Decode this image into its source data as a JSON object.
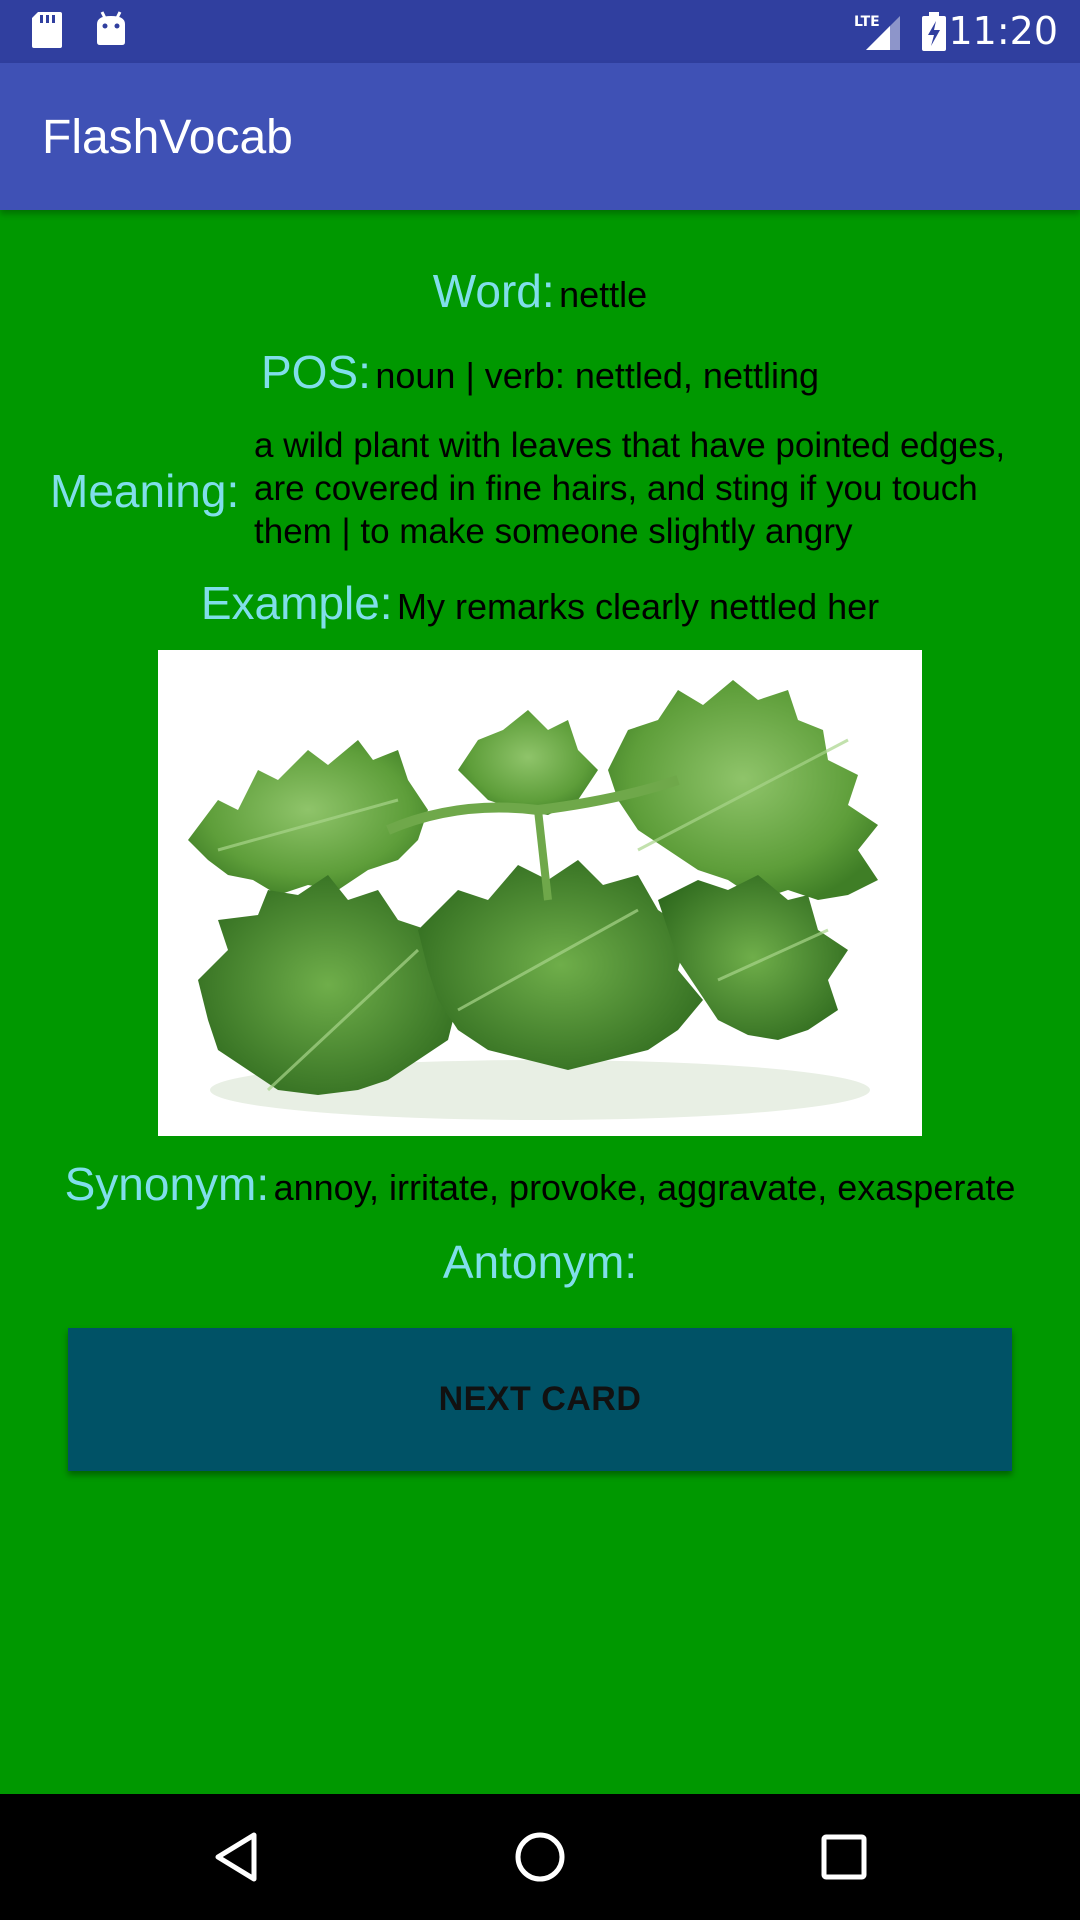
{
  "status_bar": {
    "time": "11:20",
    "network": "LTE",
    "icons": [
      "sd-card-icon",
      "android-icon",
      "signal-icon",
      "battery-charging-icon"
    ]
  },
  "app_bar": {
    "title": "FlashVocab"
  },
  "card": {
    "word_label": "Word:",
    "word": "nettle",
    "pos_label": "POS:",
    "pos": "noun | verb: nettled, nettling",
    "meaning_label": "Meaning:",
    "meaning": "a wild plant with leaves that have pointed edges, are covered in fine hairs, and sting if you touch them | to make someone slightly angry",
    "example_label": "Example:",
    "example": "My remarks clearly nettled her",
    "synonym_label": "Synonym:",
    "synonym": "annoy, irritate, provoke, aggravate, exasperate",
    "antonym_label": "Antonym:",
    "antonym": ""
  },
  "button": {
    "next_label": "NEXT CARD"
  },
  "nav_bar": {
    "icons": [
      "back-icon",
      "home-icon",
      "recents-icon"
    ]
  },
  "colors": {
    "status_bar": "#303F9F",
    "app_bar": "#3F51B5",
    "background": "#009800",
    "label": "#80DEEA",
    "button": "#005266"
  }
}
